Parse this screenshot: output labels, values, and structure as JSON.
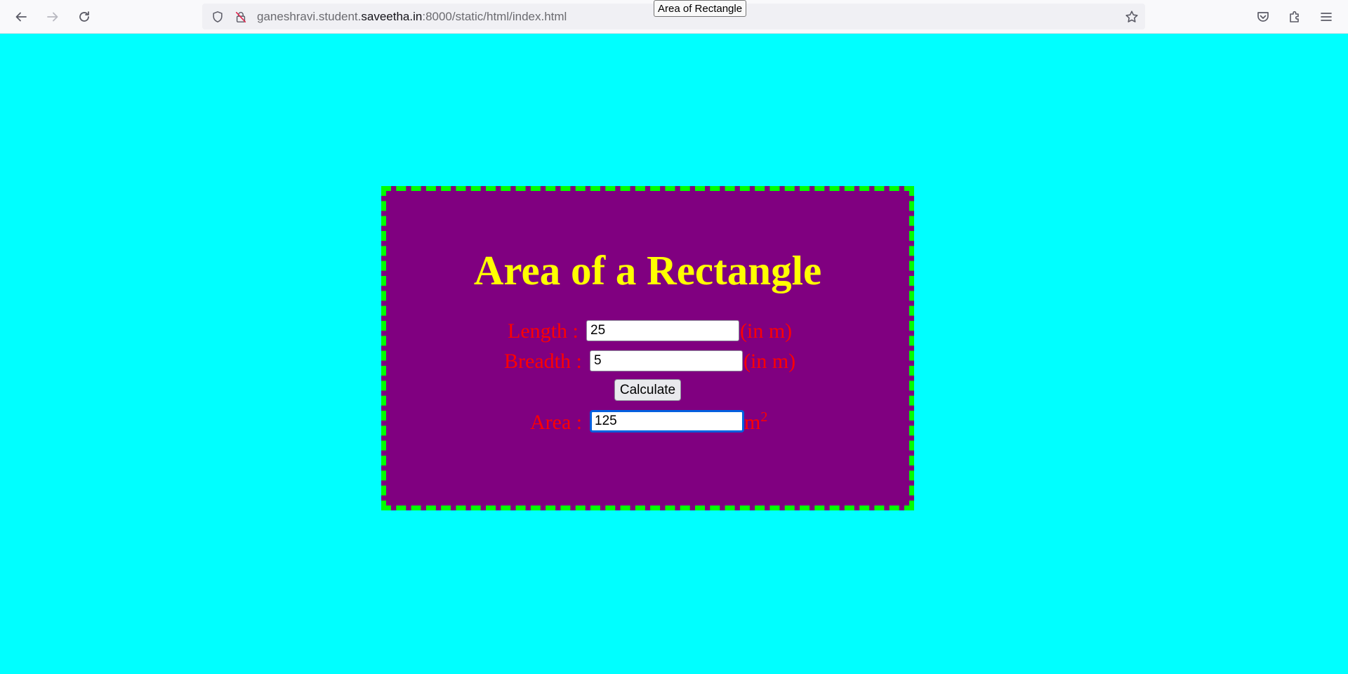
{
  "browser": {
    "url_prefix": "ganeshravi.student.",
    "url_domain": "saveetha.in",
    "url_suffix": ":8000/static/html/index.html",
    "tooltip": "Area of Rectangle",
    "icons": {
      "back": "arrow-left-icon",
      "forward": "arrow-right-icon",
      "reload": "reload-icon",
      "tracking": "shield-icon",
      "connection": "insecure-lock-icon",
      "bookmark": "star-icon",
      "pocket": "pocket-icon",
      "extensions": "puzzle-icon",
      "menu": "hamburger-menu-icon"
    }
  },
  "page": {
    "background": "#00ffff",
    "card_background": "#800080",
    "card_border": "#00ff00",
    "title": "Area of a Rectangle",
    "title_color": "#ffff00",
    "label_color": "#ff0000",
    "length_label": "Length :",
    "length_value": "25",
    "length_unit": "(in m)",
    "breadth_label": "Breadth :",
    "breadth_value": "5",
    "breadth_unit": "(in m)",
    "calculate_label": "Calculate",
    "area_label": "Area :",
    "area_value": "125",
    "area_unit": "m",
    "area_unit_sup": "2"
  }
}
